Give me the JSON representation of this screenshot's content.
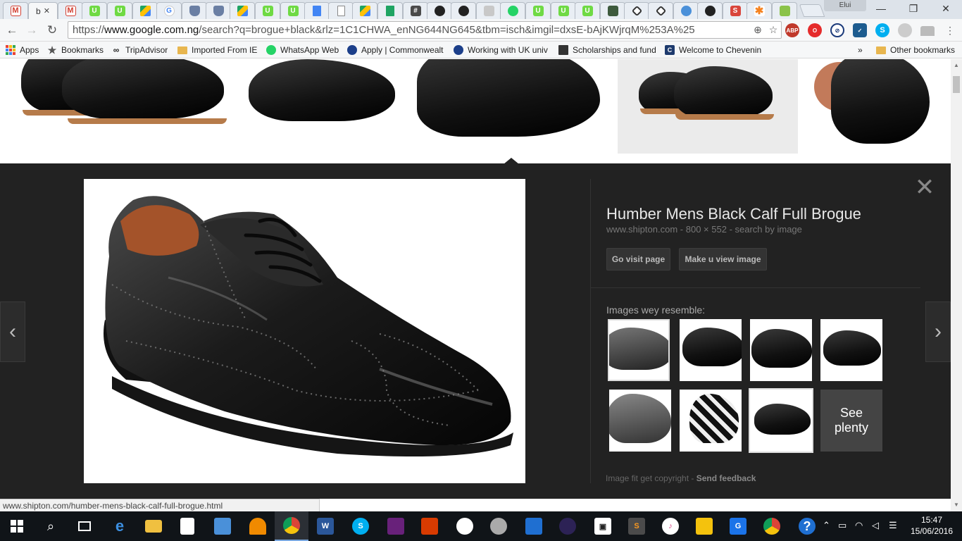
{
  "browser": {
    "active_tab_short": "b",
    "profile_name": "Elui",
    "url_prefix": "https://",
    "url_host": "www.google.com.ng",
    "url_path": "/search?q=brogue+black&rlz=1C1CHWA_enNG644NG645&tbm=isch&imgil=dxsE-bAjKWjrqM%253A%25"
  },
  "bookmarks": [
    {
      "label": "Apps",
      "icon": "apps-grid-icon"
    },
    {
      "label": "Bookmarks",
      "icon": "star-icon"
    },
    {
      "label": "TripAdvisor",
      "icon": "owl-icon"
    },
    {
      "label": "Imported From IE",
      "icon": "folder-icon"
    },
    {
      "label": "WhatsApp Web",
      "icon": "whatsapp-icon"
    },
    {
      "label": "Apply | Commonwealt",
      "icon": "globe-icon"
    },
    {
      "label": "Working with UK univ",
      "icon": "globe-icon"
    },
    {
      "label": "Scholarships and fund",
      "icon": "site-icon"
    },
    {
      "label": "Welcome to Chevenin",
      "icon": "c-icon"
    }
  ],
  "bookmarks_overflow": "»",
  "other_bookmarks": "Other bookmarks",
  "viewer": {
    "title": "Humber Mens Black Calf Full Brogue",
    "source": "www.shipton.com",
    "dimensions": "800 × 552",
    "search_by_image": "search by image",
    "visit_button": "Go visit page",
    "view_button": "Make u view image",
    "similar_label": "Images wey resemble:",
    "see_more_line1": "See",
    "see_more_line2": "plenty",
    "copyright_text": "Image fit get copyright",
    "feedback": "Send feedback",
    "close": "✕",
    "prev": "‹",
    "next": "›"
  },
  "status_url": "www.shipton.com/humber-mens-black-calf-full-brogue.html",
  "taskbar": {
    "time": "15:47",
    "date": "15/06/2016"
  }
}
